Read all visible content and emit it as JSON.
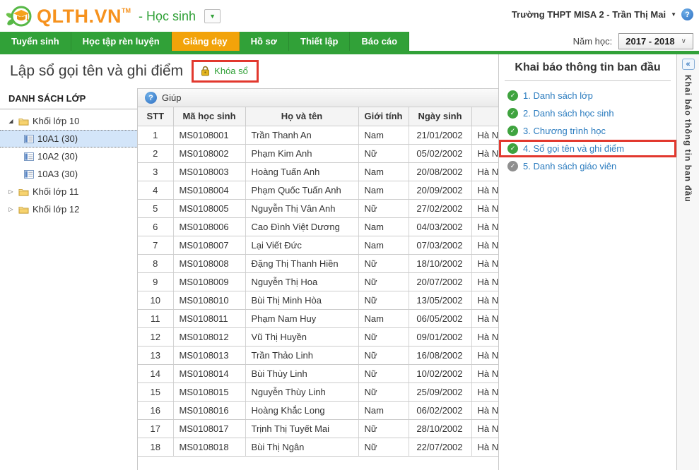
{
  "header": {
    "logo_text": "QLTH.VN",
    "logo_tm": "TM",
    "scope": "- Học sinh",
    "account_name": "Trường THPT MISA 2 - Trần Thị Mai",
    "year_label": "Năm học:",
    "year_value": "2017 - 2018"
  },
  "nav": {
    "tabs": [
      {
        "label": "Tuyển sinh",
        "active": false
      },
      {
        "label": "Học tập rèn luyện",
        "active": false
      },
      {
        "label": "Giảng dạy",
        "active": true
      },
      {
        "label": "Hồ sơ",
        "active": false
      },
      {
        "label": "Thiết lập",
        "active": false
      },
      {
        "label": "Báo cáo",
        "active": false
      }
    ]
  },
  "page": {
    "title": "Lập sổ gọi tên và ghi điểm",
    "lock_button_label": "Khóa sổ"
  },
  "sidebar": {
    "title": "DANH SÁCH LỚP",
    "tree": [
      {
        "label": "Khối lớp 10",
        "type": "folder",
        "expanded": true,
        "selected": false
      },
      {
        "label": "10A1 (30)",
        "type": "class",
        "selected": true
      },
      {
        "label": "10A2 (30)",
        "type": "class",
        "selected": false
      },
      {
        "label": "10A3 (30)",
        "type": "class",
        "selected": false
      },
      {
        "label": "Khối lớp 11",
        "type": "folder",
        "expanded": false,
        "selected": false
      },
      {
        "label": "Khối lớp 12",
        "type": "folder",
        "expanded": false,
        "selected": false
      }
    ]
  },
  "toolbar": {
    "help_label": "Giúp"
  },
  "table": {
    "columns": [
      "STT",
      "Mã học sinh",
      "Họ và tên",
      "Giới tính",
      "Ngày sinh",
      ""
    ],
    "rows": [
      [
        "1",
        "MS0108001",
        "Trần Thanh An",
        "Nam",
        "21/01/2002",
        "Hà Nội"
      ],
      [
        "2",
        "MS0108002",
        "Phạm Kim Anh",
        "Nữ",
        "05/02/2002",
        "Hà Nội"
      ],
      [
        "3",
        "MS0108003",
        "Hoàng Tuấn Anh",
        "Nam",
        "20/08/2002",
        "Hà Nội"
      ],
      [
        "4",
        "MS0108004",
        "Phạm Quốc Tuấn Anh",
        "Nam",
        "20/09/2002",
        "Hà Nội"
      ],
      [
        "5",
        "MS0108005",
        "Nguyễn Thị Vân Anh",
        "Nữ",
        "27/02/2002",
        "Hà Nội"
      ],
      [
        "6",
        "MS0108006",
        "Cao Đình Việt Dương",
        "Nam",
        "04/03/2002",
        "Hà Nội"
      ],
      [
        "7",
        "MS0108007",
        "Lại Viết Đức",
        "Nam",
        "07/03/2002",
        "Hà Nội"
      ],
      [
        "8",
        "MS0108008",
        "Đặng Thị Thanh Hiền",
        "Nữ",
        "18/10/2002",
        "Hà Nội"
      ],
      [
        "9",
        "MS0108009",
        "Nguyễn Thị Hoa",
        "Nữ",
        "20/07/2002",
        "Hà Nội"
      ],
      [
        "10",
        "MS0108010",
        "Bùi Thị Minh Hòa",
        "Nữ",
        "13/05/2002",
        "Hà Nội"
      ],
      [
        "11",
        "MS0108011",
        "Phạm Nam Huy",
        "Nam",
        "06/05/2002",
        "Hà Nội"
      ],
      [
        "12",
        "MS0108012",
        "Vũ Thị Huyền",
        "Nữ",
        "09/01/2002",
        "Hà Nội"
      ],
      [
        "13",
        "MS0108013",
        "Trần Thảo Linh",
        "Nữ",
        "16/08/2002",
        "Hà Nội"
      ],
      [
        "14",
        "MS0108014",
        "Bùi Thùy Linh",
        "Nữ",
        "10/02/2002",
        "Hà Nội"
      ],
      [
        "15",
        "MS0108015",
        "Nguyễn Thùy Linh",
        "Nữ",
        "25/09/2002",
        "Hà Nội"
      ],
      [
        "16",
        "MS0108016",
        "Hoàng Khắc Long",
        "Nam",
        "06/02/2002",
        "Hà Nội"
      ],
      [
        "17",
        "MS0108017",
        "Trịnh Thị Tuyết Mai",
        "Nữ",
        "28/10/2002",
        "Hà Nội"
      ],
      [
        "18",
        "MS0108018",
        "Bùi Thị Ngân",
        "Nữ",
        "22/07/2002",
        "Hà Nội"
      ]
    ]
  },
  "panel": {
    "title": "Khai báo thông tin ban đầu",
    "steps": [
      {
        "label": "1. Danh sách lớp",
        "status": "done",
        "highlighted": false
      },
      {
        "label": "2. Danh sách học sinh",
        "status": "done",
        "highlighted": false
      },
      {
        "label": "3. Chương trình học",
        "status": "done",
        "highlighted": false
      },
      {
        "label": "4. Sổ gọi tên và ghi điểm",
        "status": "done",
        "highlighted": true
      },
      {
        "label": "5. Danh sách giáo viên",
        "status": "pending",
        "highlighted": false
      }
    ],
    "vertical_tab_label": "Khai báo thông tin ban đầu"
  },
  "icons": {
    "help": "?",
    "caret_down": "▼",
    "chevron_down": "∨",
    "collapse": "«",
    "check": "✓",
    "tree_expanded": "◢",
    "tree_collapsed": "▷",
    "logo": "graduation-cap-with-leaves",
    "lock": "gold-padlock",
    "folder": "yellow-folder",
    "class_item": "list-form"
  },
  "colors": {
    "nav_green": "#31a138",
    "active_tab_orange": "#f2a30a",
    "logo_orange": "#f6921e",
    "link_blue": "#2b7cbf",
    "highlight_red": "#e2382e",
    "lock_gold": "#e3b51f",
    "done_green": "#3fa33f",
    "pending_gray": "#8f8f8f",
    "selected_row_blue": "#d3e5f9"
  }
}
